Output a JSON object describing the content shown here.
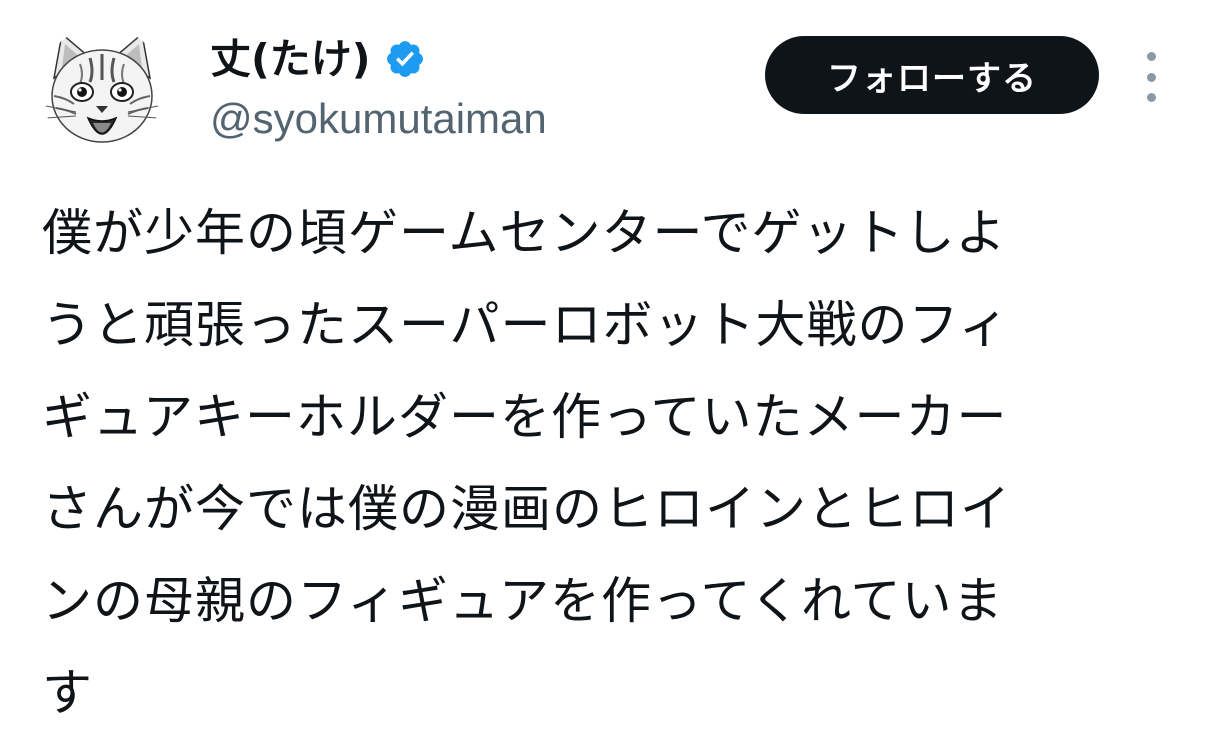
{
  "author": {
    "display_name": "丈(たけ)",
    "handle": "@syokumutaiman",
    "verified_icon": "verified-badge-icon",
    "avatar_icon": "cat-avatar-icon"
  },
  "actions": {
    "follow_label": "フォローする",
    "more_icon": "more-vertical-icon"
  },
  "tweet": {
    "lines": [
      "僕が少年の頃ゲームセンターでゲットしよ",
      "うと頑張ったスーパーロボット大戦のフィ",
      "ギュアキーホルダーを作っていたメーカー",
      "さんが今では僕の漫画のヒロインとヒロイ",
      "ンの母親のフィギュアを作ってくれていま",
      "す"
    ]
  },
  "colors": {
    "text_primary": "#0f1419",
    "text_secondary": "#536471",
    "verified_blue": "#1d9bf0",
    "button_bg": "#0f1419",
    "button_text": "#ffffff"
  }
}
